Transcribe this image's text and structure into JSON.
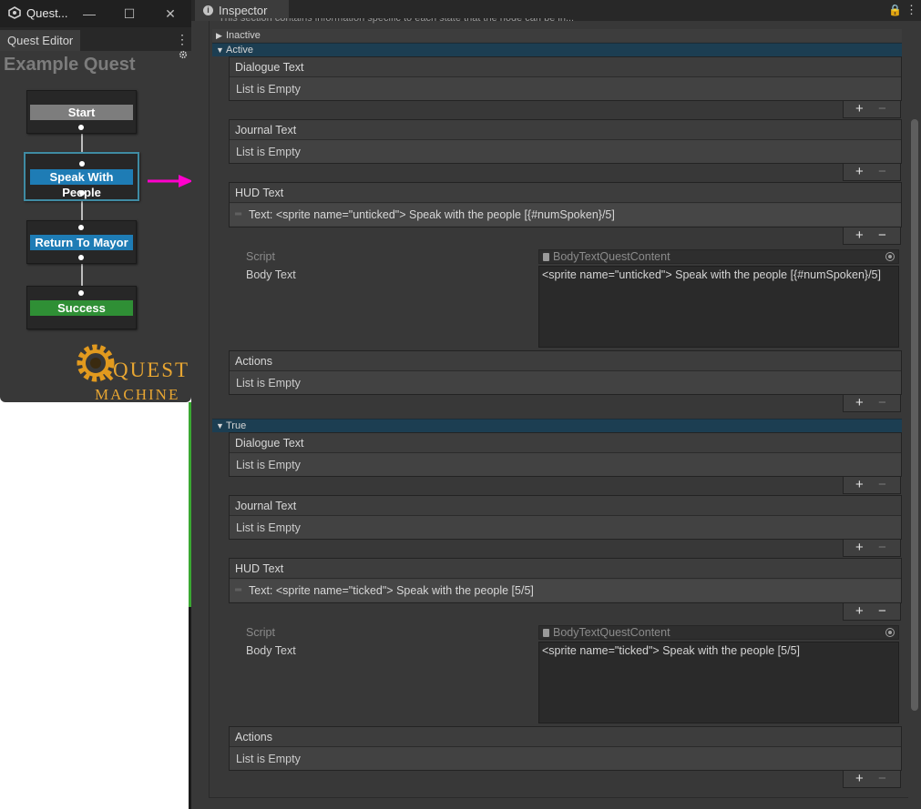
{
  "quest_editor": {
    "window_title": "Quest...",
    "tab_label": "Quest Editor",
    "quest_title": "Example Quest",
    "nodes": [
      {
        "label": "Start",
        "color": "#7d7d7d"
      },
      {
        "label": "Speak With People",
        "color": "#1e7cb5"
      },
      {
        "label": "Return To Mayor",
        "color": "#1e7cb5"
      },
      {
        "label": "Success",
        "color": "#2f8f35"
      }
    ],
    "logo_line1": "QUEST",
    "logo_line2": "MACHINE",
    "arrow_color": "#ff00cc"
  },
  "inspector": {
    "tab_label": "Inspector",
    "truncated_intro": "This section contains information specific to each state that the node can be in...",
    "states": [
      {
        "label": "Inactive",
        "expanded": false
      },
      {
        "label": "Active",
        "expanded": true
      },
      {
        "label": "True",
        "expanded": true
      }
    ],
    "active": {
      "dialogue_header": "Dialogue Text",
      "dialogue_empty": "List is Empty",
      "journal_header": "Journal Text",
      "journal_empty": "List is Empty",
      "hud_header": "HUD Text",
      "hud_item": "Text: <sprite name=\"unticked\"> Speak with the people [{#numSpoken}/5]",
      "script_label": "Script",
      "script_value": "BodyTextQuestContent",
      "body_label": "Body Text",
      "body_value": "<sprite name=\"unticked\"> Speak with the people [{#numSpoken}/5]",
      "actions_header": "Actions",
      "actions_empty": "List is Empty"
    },
    "true_state": {
      "dialogue_header": "Dialogue Text",
      "dialogue_empty": "List is Empty",
      "journal_header": "Journal Text",
      "journal_empty": "List is Empty",
      "hud_header": "HUD Text",
      "hud_item": "Text: <sprite name=\"ticked\"> Speak with the people [5/5]",
      "script_label": "Script",
      "script_value": "BodyTextQuestContent",
      "body_label": "Body Text",
      "body_value": "<sprite name=\"ticked\"> Speak with the people [5/5]",
      "actions_header": "Actions",
      "actions_empty": "List is Empty"
    },
    "plus_symbol": "+",
    "minus_symbol": "−"
  }
}
